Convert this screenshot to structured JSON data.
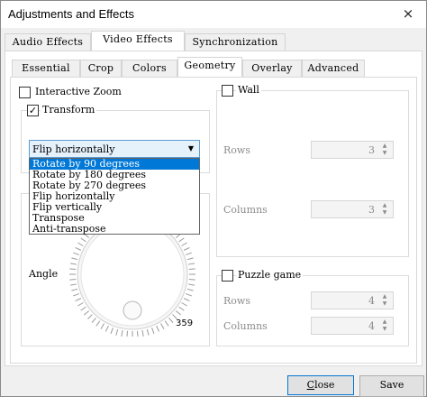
{
  "window": {
    "title": "Adjustments and Effects",
    "close_icon": "×"
  },
  "tabs": [
    "Audio Effects",
    "Video Effects",
    "Synchronization"
  ],
  "subtabs": [
    "Essential",
    "Crop",
    "Colors",
    "Geometry",
    "Overlay",
    "Advanced"
  ],
  "geometry": {
    "interactive_zoom_label": "Interactive Zoom",
    "transform_label": "Transform",
    "transform_checked_mark": "✓",
    "transform_selected": "Flip horizontally",
    "transform_options": [
      "Rotate by 90 degrees",
      "Rotate by 180 degrees",
      "Rotate by 270 degrees",
      "Flip horizontally",
      "Flip vertically",
      "Transpose",
      "Anti-transpose"
    ],
    "highlighted_option": "Rotate by 90 degrees",
    "angle_label": "Angle",
    "angle_max_label": "359"
  },
  "wall": {
    "label": "Wall",
    "rows_label": "Rows",
    "rows_value": "3",
    "columns_label": "Columns",
    "columns_value": "3"
  },
  "puzzle": {
    "label": "Puzzle game",
    "rows_label": "Rows",
    "rows_value": "4",
    "columns_label": "Columns",
    "columns_value": "4"
  },
  "buttons": {
    "close_accel": "C",
    "close_rest": "lose",
    "save_label": "Save"
  },
  "colors": {
    "selection": "#0078d7",
    "combo_bg": "#e5f1fb"
  }
}
